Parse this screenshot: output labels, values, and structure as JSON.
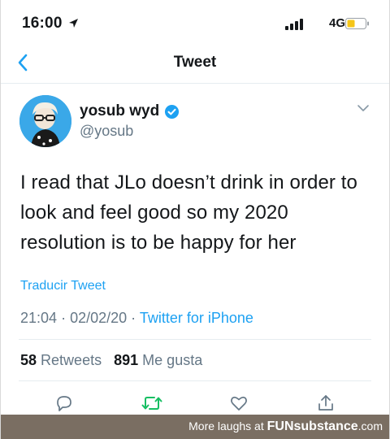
{
  "status_bar": {
    "time": "16:00",
    "network": "4G"
  },
  "nav": {
    "title": "Tweet"
  },
  "tweet": {
    "author_name": "yosub wyd",
    "handle": "@yosub",
    "text": "I read that JLo doesn’t drink in order to look and feel good so my 2020 resolution is to be happy for her",
    "translate_label": "Traducir Tweet",
    "time": "21:04",
    "date": "02/02/20",
    "separator": "·",
    "source": "Twitter for iPhone",
    "retweets_count": "58",
    "retweets_label": "Retweets",
    "likes_count": "891",
    "likes_label": "Me gusta"
  },
  "banner": {
    "text": "More laughs at ",
    "brand": "FUNsubstance",
    "domain": ".com"
  },
  "colors": {
    "accent": "#1da1f2",
    "retweet": "#17bf63",
    "secondary": "#657786",
    "banner": "#7a6e62"
  }
}
